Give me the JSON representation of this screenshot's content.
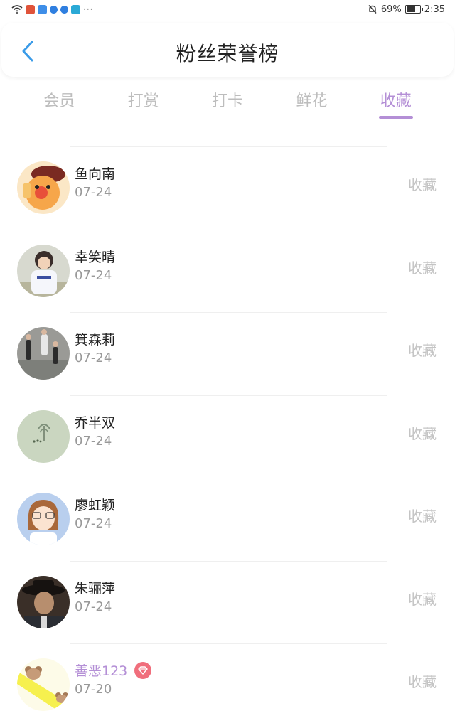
{
  "status_bar": {
    "battery": "69%",
    "time": "2:35",
    "battery_level": 0.69
  },
  "header": {
    "title": "粉丝荣誉榜"
  },
  "tabs": [
    {
      "label": "会员",
      "active": false
    },
    {
      "label": "打赏",
      "active": false
    },
    {
      "label": "打卡",
      "active": false
    },
    {
      "label": "鲜花",
      "active": false
    },
    {
      "label": "收藏",
      "active": true
    }
  ],
  "colors": {
    "accent": "#b48fd6",
    "inactive_tab": "#bdbdbd",
    "vip_badge": "#f06e7c"
  },
  "fans": [
    {
      "name": "鱼向南",
      "date": "07-24",
      "action": "收藏"
    },
    {
      "name": "幸笑晴",
      "date": "07-24",
      "action": "收藏"
    },
    {
      "name": "箕森莉",
      "date": "07-24",
      "action": "收藏"
    },
    {
      "name": "乔半双",
      "date": "07-24",
      "action": "收藏"
    },
    {
      "name": "廖虹颖",
      "date": "07-24",
      "action": "收藏"
    },
    {
      "name": "朱骊萍",
      "date": "07-24",
      "action": "收藏"
    },
    {
      "name": "善恶123",
      "date": "07-20",
      "action": "收藏",
      "vip": true
    }
  ]
}
